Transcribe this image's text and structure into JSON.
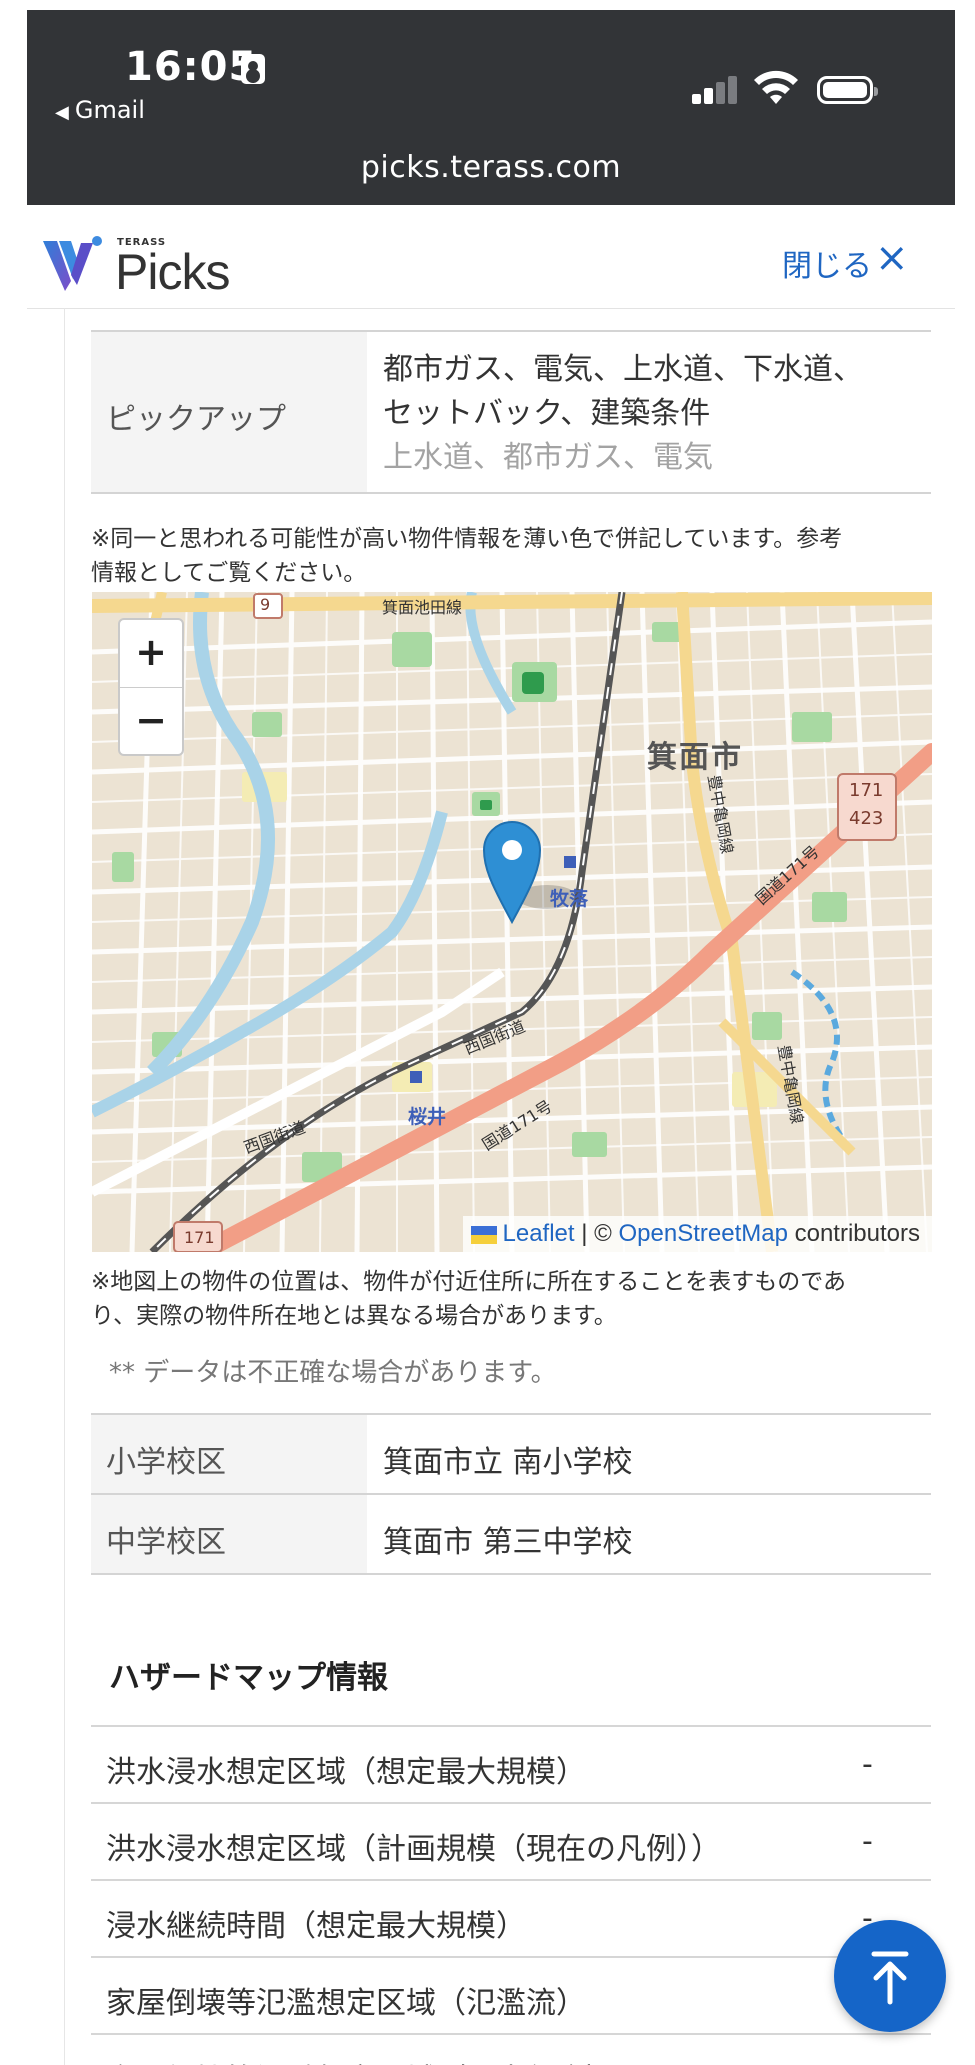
{
  "status_bar": {
    "time": "16:05",
    "back_app": "Gmail",
    "url": "picks.terass.com"
  },
  "header": {
    "logo_small": "TERASS",
    "logo_text": "Picks",
    "close_label": "閉じる",
    "close_icon": "×"
  },
  "pickup": {
    "label": "ピックアップ",
    "value_line1": "都市ガス、電気、上水道、下水道、",
    "value_line2": "セットバック、建築条件",
    "value_muted": "上水道、都市ガス、電気"
  },
  "notes": {
    "similar_line1": "※同一と思われる可能性が高い物件情報を薄い色で併記しています。参考",
    "similar_line2": "情報としてご覧ください。",
    "map_line1": "※地図上の物件の位置は、物件が付近住所に所在することを表すものであ",
    "map_line2": "り、実際の物件所在地とは異なる場合があります。",
    "data_disclaimer": "** データは不正確な場合があります。"
  },
  "map": {
    "zoom_in": "+",
    "zoom_out": "−",
    "city_label": "箕面市",
    "station_makiochi": "牧落",
    "station_sakurai": "桜井",
    "road_national171_a": "国道171号",
    "road_national171_b": "国道171号",
    "road_saigoku_a": "西国街道",
    "road_saigoku_b": "西国街道",
    "road_minoikeda": "箕面池田線",
    "road_toyonaka_a": "豊中亀岡線",
    "road_toyonaka_b": "豊中亀岡線",
    "road_9": "9",
    "route_shield_1": "171",
    "route_shield_2": "423",
    "route_shield_bottom": "171",
    "attrib_leaflet": "Leaflet",
    "attrib_sep": " | © ",
    "attrib_osm": "OpenStreetMap",
    "attrib_contrib": " contributors"
  },
  "school": {
    "elem_label": "小学校区",
    "elem_value": "箕面市立 南小学校",
    "junior_label": "中学校区",
    "junior_value": "箕面市 第三中学校"
  },
  "hazard": {
    "title": "ハザードマップ情報",
    "rows": [
      {
        "label": "洪水浸水想定区域（想定最大規模）",
        "value": "-"
      },
      {
        "label": "洪水浸水想定区域（計画規模（現在の凡例））",
        "value": "-"
      },
      {
        "label": "浸水継続時間（想定最大規模）",
        "value": "-"
      },
      {
        "label": "家屋倒壊等氾濫想定区域（氾濫流）",
        "value": ""
      },
      {
        "label": "家屋倒壊等氾濫想定区域（河岸侵食）",
        "value": ""
      }
    ]
  },
  "colors": {
    "status_bg": "#323437",
    "accent": "#1f66c2",
    "fab": "#1565c8",
    "primary_road": "#f29e86",
    "marker": "#2e8fd4"
  },
  "icons": {
    "back": "◀",
    "scroll_top": "scroll-to-top-icon"
  }
}
